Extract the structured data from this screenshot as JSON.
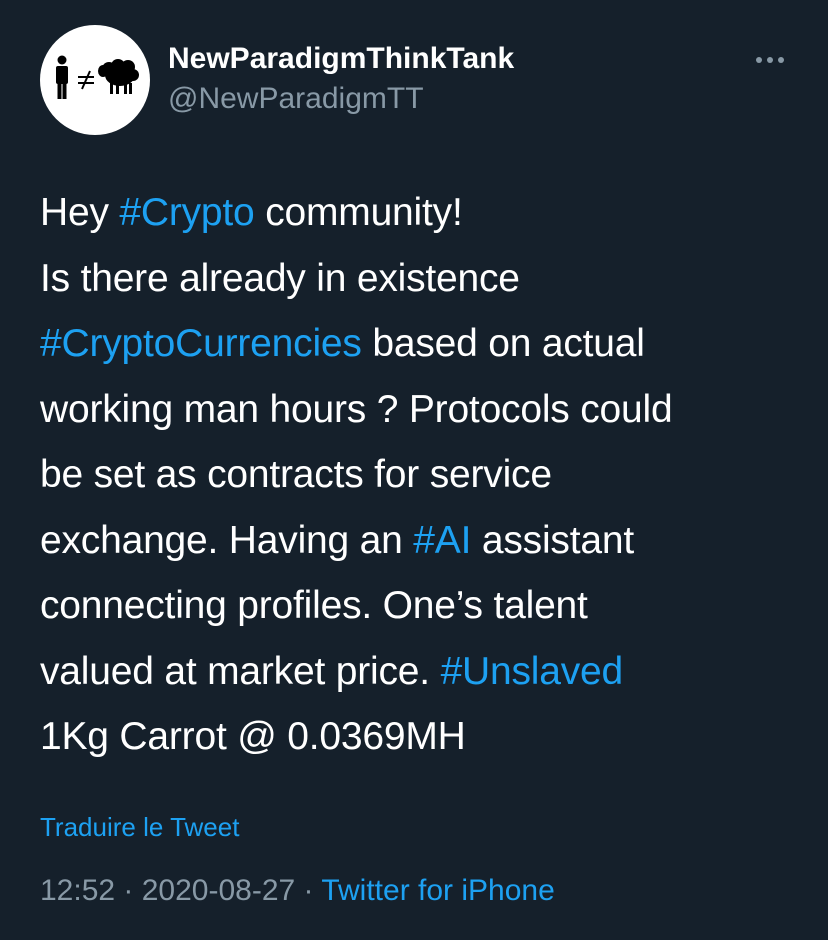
{
  "author": {
    "display_name": "NewParadigmThinkTank",
    "handle": "@NewParadigmTT",
    "avatar_icon": "person-not-equal-sheep-icon"
  },
  "menu": {
    "icon": "more-horizontal-icon"
  },
  "tweet": {
    "line1": {
      "before": "Hey ",
      "hashtag": "#Crypto",
      "after": " community!"
    },
    "line2": {
      "text": "Is there already in existence"
    },
    "line3": {
      "hashtag": "#CryptoCurrencies",
      "after": " based on actual"
    },
    "line4": {
      "text": "working man hours ? Protocols could"
    },
    "line5": {
      "text": "be set as contracts for service"
    },
    "line6": {
      "before": "exchange. Having an ",
      "hashtag": "#AI",
      "after": " assistant"
    },
    "line7": {
      "text": "connecting profiles. One’s talent"
    },
    "line8": {
      "before": "valued at market price. ",
      "hashtag": "#Unslaved"
    },
    "line9": {
      "text": "1Kg Carrot @ 0.0369MH"
    }
  },
  "translate_label": "Traduire le Tweet",
  "meta": {
    "time": "12:52",
    "separator": " · ",
    "date": "2020-08-27",
    "source": "Twitter for iPhone"
  },
  "colors": {
    "background": "#15202b",
    "text": "#ffffff",
    "muted": "#8899a6",
    "accent": "#1da1f2"
  }
}
